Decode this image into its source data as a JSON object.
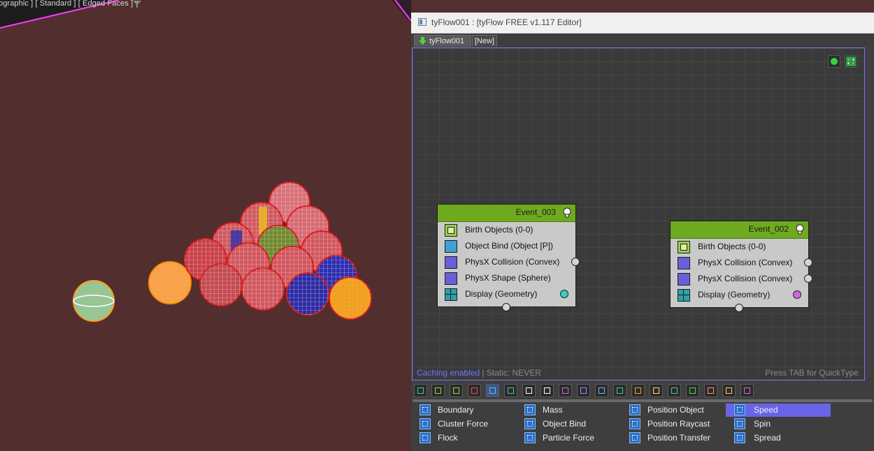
{
  "viewport": {
    "label": "ographic ] [ Standard ] [ Edged Faces ]",
    "icons": [
      "filter-icon"
    ]
  },
  "editor": {
    "title": "tyFlow001 : [tyFlow FREE v1.117 Editor]",
    "tabs": [
      {
        "label": "tyFlow001",
        "icon": "green-down-arrow-icon"
      },
      {
        "label": "[New]"
      }
    ],
    "canvas": {
      "status_caching": "Caching enabled",
      "status_static": " | Static: NEVER",
      "hint": "Press TAB for QuickType",
      "events": [
        {
          "name": "Event_003",
          "operators": [
            "Birth Objects (0-0)",
            "Object Bind (Object [P])",
            "PhysX Collision (Convex)",
            "PhysX Shape (Sphere)",
            "Display (Geometry)"
          ],
          "display_color": "#2fd3c4"
        },
        {
          "name": "Event_002",
          "operators": [
            "Birth Objects (0-0)",
            "PhysX Collision (Convex)",
            "PhysX Collision (Convex)",
            "Display (Geometry)"
          ],
          "display_color": "#d568d8"
        }
      ]
    },
    "operator_columns": [
      [
        "Boundary",
        "Cluster Force",
        "Flock"
      ],
      [
        "Mass",
        "Object Bind",
        "Particle Force"
      ],
      [
        "Position Object",
        "Position Raycast",
        "Position Transfer"
      ],
      [
        "Speed",
        "Spin",
        "Spread"
      ]
    ],
    "selected_operator": "Speed"
  },
  "colors": {
    "event_header": "#6eaa1e",
    "canvas_border": "#7c74ff",
    "selection": "#6963e6"
  }
}
